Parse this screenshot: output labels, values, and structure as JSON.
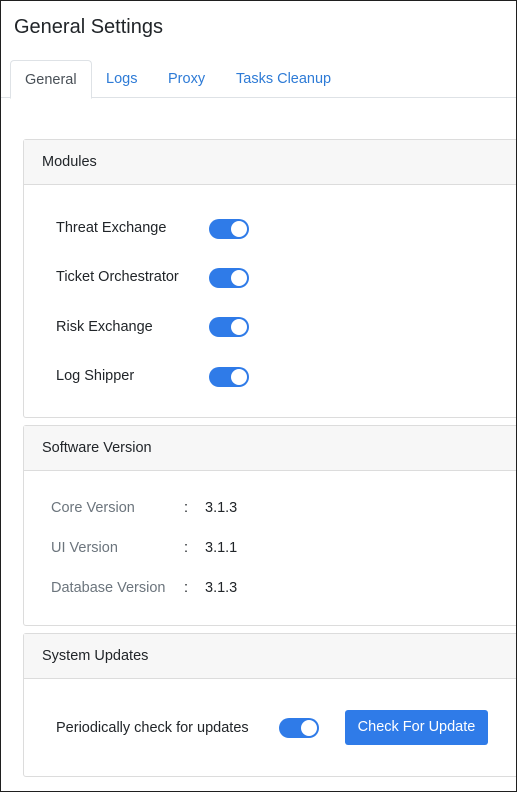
{
  "page": {
    "title": "General Settings"
  },
  "tabs": [
    {
      "label": "General",
      "active": true
    },
    {
      "label": "Logs",
      "active": false
    },
    {
      "label": "Proxy",
      "active": false
    },
    {
      "label": "Tasks Cleanup",
      "active": false
    }
  ],
  "modules": {
    "header": "Modules",
    "items": [
      {
        "label": "Threat Exchange",
        "enabled": true
      },
      {
        "label": "Ticket Orchestrator",
        "enabled": true
      },
      {
        "label": "Risk Exchange",
        "enabled": true
      },
      {
        "label": "Log Shipper",
        "enabled": true
      }
    ]
  },
  "software_version": {
    "header": "Software Version",
    "separator": ":",
    "rows": [
      {
        "label": "Core Version",
        "value": "3.1.3"
      },
      {
        "label": "UI Version",
        "value": "3.1.1"
      },
      {
        "label": "Database Version",
        "value": "3.1.3"
      }
    ]
  },
  "system_updates": {
    "header": "System Updates",
    "periodic_label": "Periodically check for updates",
    "periodic_enabled": true,
    "check_button_label": "Check For Update"
  },
  "colors": {
    "accent": "#2f7be8",
    "link": "#2e7bd6",
    "muted_text": "#6c757d",
    "card_header_bg": "#f7f7f7"
  }
}
